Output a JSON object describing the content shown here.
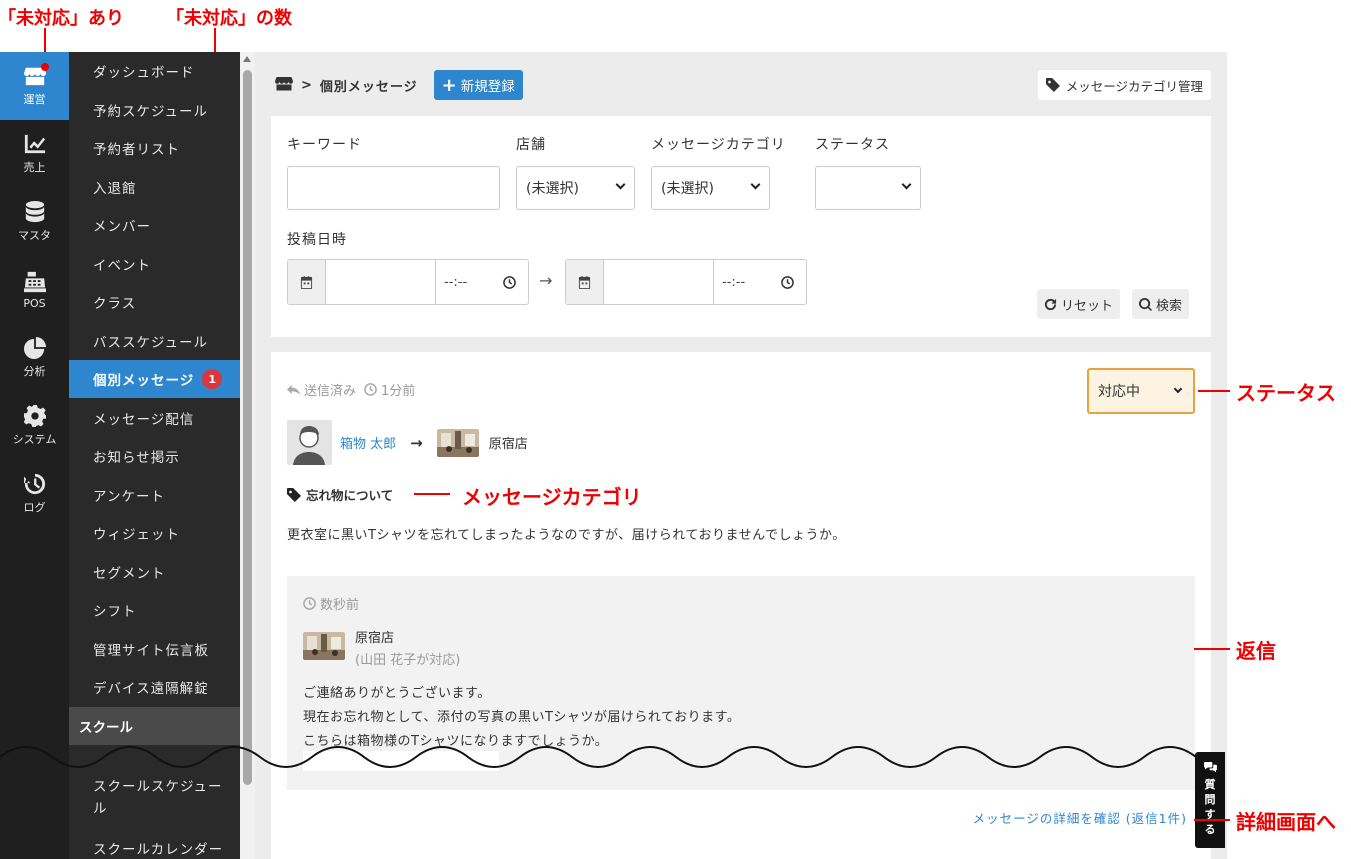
{
  "annotations": {
    "unhandled_exists": "「未対応」あり",
    "unhandled_count": "「未対応」の数",
    "status": "ステータス",
    "message_category": "メッセージカテゴリ",
    "reply": "返信",
    "to_detail": "詳細画面へ"
  },
  "rail": [
    {
      "label": "運営",
      "icon": "store-icon",
      "active": true
    },
    {
      "label": "売上",
      "icon": "chart-line-icon"
    },
    {
      "label": "マスタ",
      "icon": "database-icon"
    },
    {
      "label": "POS",
      "icon": "cash-register-icon"
    },
    {
      "label": "分析",
      "icon": "pie-chart-icon"
    },
    {
      "label": "システム",
      "icon": "gear-icon"
    },
    {
      "label": "ログ",
      "icon": "history-icon"
    }
  ],
  "menu": [
    "ダッシュボード",
    "予約スケジュール",
    "予約者リスト",
    "入退館",
    "メンバー",
    "イベント",
    "クラス",
    "バススケジュール",
    "個別メッセージ",
    "メッセージ配信",
    "お知らせ掲示",
    "アンケート",
    "ウィジェット",
    "セグメント",
    "シフト",
    "管理サイト伝言板",
    "デバイス遠隔解錠"
  ],
  "menu_badge": "1",
  "menu_section": "スクール",
  "menu_school": [
    "スクールスケジュール",
    "スクールカレンダー"
  ],
  "breadcrumb": {
    "title": "個別メッセージ",
    "sep": ">"
  },
  "new_button": {
    "plus": "+",
    "label": "新規登録"
  },
  "category_manage_button": "メッセージカテゴリ管理",
  "search": {
    "keyword_label": "キーワード",
    "store_label": "店舗",
    "store_value": "(未選択)",
    "category_label": "メッセージカテゴリ",
    "category_value": "(未選択)",
    "status_label": "ステータス",
    "posted_label": "投稿日時",
    "time_placeholder": "--:--",
    "range_arrow": "→",
    "reset_label": "リセット",
    "search_label": "検索"
  },
  "message": {
    "sent_status": "送信済み",
    "time_ago": "1分前",
    "status_value": "対応中",
    "sender": "箱物 太郎",
    "arrow": "→",
    "store": "原宿店",
    "category": "忘れ物について",
    "body": "更衣室に黒いTシャツを忘れてしまったようなのですが、届けられておりませんでしょうか。"
  },
  "reply": {
    "time_ago": "数秒前",
    "store": "原宿店",
    "handler": "(山田 花子が対応)",
    "lines": [
      "ご連絡ありがとうございます。",
      "現在お忘れ物として、添付の写真の黒いTシャツが届けられております。",
      "こちらは箱物様のTシャツになりますでしょうか。"
    ]
  },
  "detail_link": "メッセージの詳細を確認 (返信1件)",
  "ask_tab": [
    "質",
    "問",
    "す",
    "る"
  ],
  "colors": {
    "accent": "#2e86cf",
    "annotation": "#e00000",
    "status_border": "#e8a23a",
    "badge": "#d9363e"
  }
}
